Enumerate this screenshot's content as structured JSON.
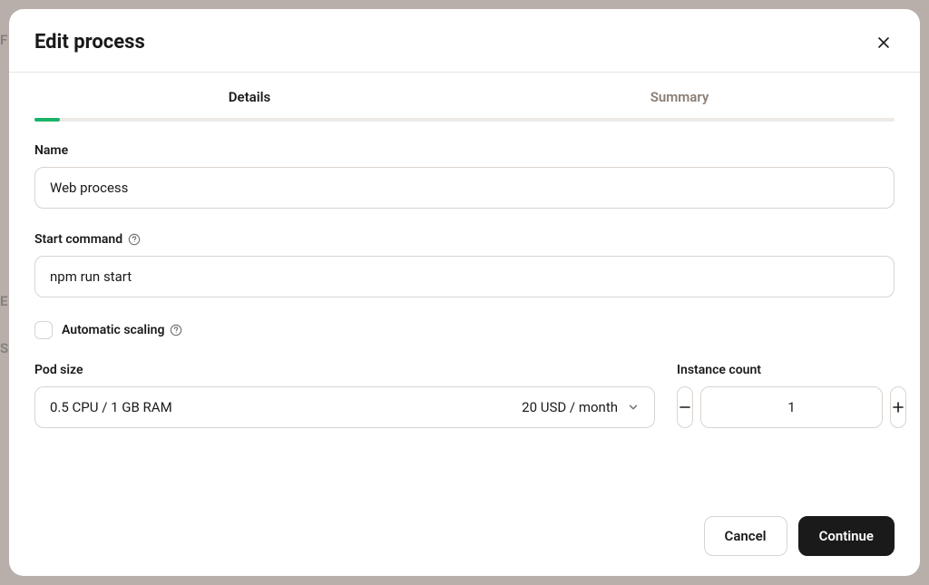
{
  "modal": {
    "title": "Edit process"
  },
  "tabs": {
    "details": "Details",
    "summary": "Summary"
  },
  "fields": {
    "name": {
      "label": "Name",
      "value": "Web process"
    },
    "start_command": {
      "label": "Start command",
      "value": "npm run start"
    },
    "auto_scaling": {
      "label": "Automatic scaling",
      "checked": false
    },
    "pod_size": {
      "label": "Pod size",
      "spec": "0.5 CPU / 1 GB RAM",
      "price": "20 USD / month"
    },
    "instance_count": {
      "label": "Instance count",
      "value": "1"
    }
  },
  "footer": {
    "cancel": "Cancel",
    "continue": "Continue"
  },
  "background": {
    "t1": "F",
    "t2": "E",
    "t3": "S"
  }
}
